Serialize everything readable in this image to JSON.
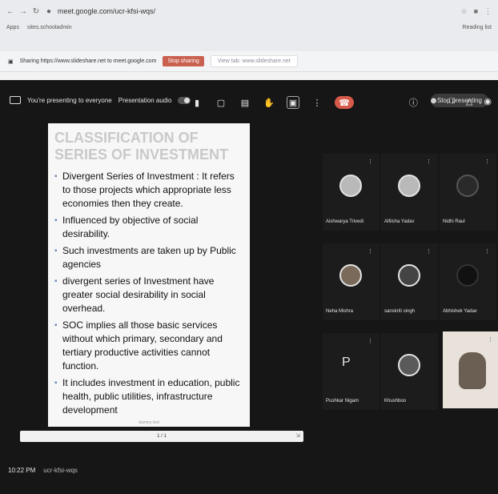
{
  "browser": {
    "url": "meet.google.com/ucr-kfsi-wqs/",
    "bookmark_apps": "Apps",
    "bookmark_item": "sites.schooladmin",
    "reading_list": "Reading list"
  },
  "sharebar": {
    "sharing_text": "Sharing https://www.slideshare.net to meet.google.com",
    "stop_sharing": "Stop sharing",
    "view_tab": "View tab: www.slideshare.net"
  },
  "presbar": {
    "presenting_text": "You're presenting to everyone",
    "presentation_audio": "Presentation audio",
    "stop_presenting": "Stop presenting"
  },
  "slide": {
    "title": "CLASSIFICATION OF SERIES OF INVESTMENT",
    "bullets": [
      "Divergent Series of Investment : It refers to those projects which appropriate less economies then they create.",
      "Influenced by objective of social desirability.",
      "Such investments are taken up by  Public agencies",
      " divergent series of Investment have greater social desirability in social overhead.",
      "SOC implies all those basic services without which primary, secondary and tertiary productive activities cannot function.",
      "It includes investment in education, public health, public utilities, infrastructure development"
    ],
    "page_number": "dummy text"
  },
  "pager": {
    "label": "1 / 1"
  },
  "participants": [
    {
      "name": "Aishwarya Trivedi"
    },
    {
      "name": "Alfiisha Yadav"
    },
    {
      "name": "Nidhi Raul"
    },
    {
      "name": "Neha Mishra"
    },
    {
      "name": "sanskriti singh"
    },
    {
      "name": "Abhishek Yadav"
    },
    {
      "name": "Pushkar Nigam",
      "letter": "P"
    },
    {
      "name": "Khushboo"
    },
    {
      "name": ""
    }
  ],
  "toolbar": {
    "time": "10:22 PM",
    "meeting_code": "ucr-kfsi-wqs"
  }
}
